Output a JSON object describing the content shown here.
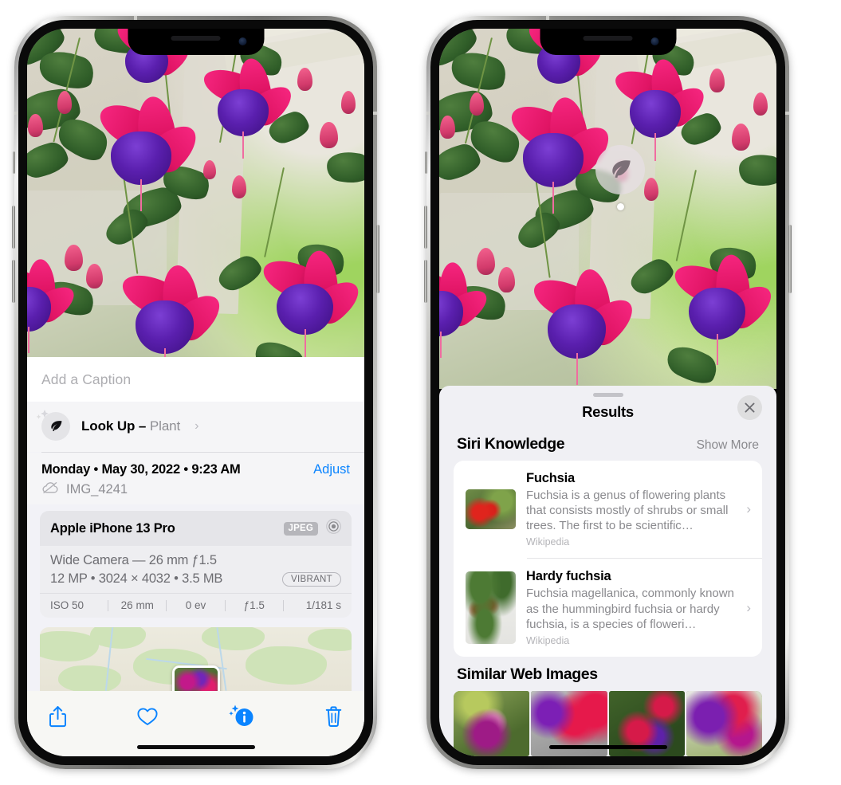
{
  "left_phone": {
    "caption": {
      "placeholder": "Add a Caption"
    },
    "lookup": {
      "label": "Look Up – ",
      "subject": "Plant",
      "chevron": "›",
      "icon": "leaf-icon"
    },
    "meta": {
      "date": "Monday • May 30, 2022 • 9:23 AM",
      "adjust": "Adjust",
      "filename": "IMG_4241",
      "cloud_icon": "cloud-slash-icon"
    },
    "camera": {
      "device": "Apple iPhone 13 Pro",
      "format_badge": "JPEG",
      "lens_icon": "aperture-icon",
      "lens_line": "Wide Camera — 26 mm ƒ1.5",
      "size_line": "12 MP • 3024 × 4032 • 3.5 MB",
      "style_badge": "VIBRANT",
      "exif": [
        "ISO 50",
        "26 mm",
        "0 ev",
        "ƒ1.5",
        "1/181 s"
      ]
    },
    "toolbar": [
      {
        "name": "share-button",
        "icon": "share-icon"
      },
      {
        "name": "favorite-button",
        "icon": "heart-icon"
      },
      {
        "name": "info-button",
        "icon": "info-sparkle-icon"
      },
      {
        "name": "delete-button",
        "icon": "trash-icon"
      }
    ]
  },
  "right_phone": {
    "visual_lookup_badge": {
      "icon": "leaf-icon"
    },
    "sheet": {
      "title": "Results",
      "close_icon": "close-icon"
    },
    "siri_knowledge": {
      "title": "Siri Knowledge",
      "show_more": "Show More",
      "items": [
        {
          "title": "Fuchsia",
          "description": "Fuchsia is a genus of flowering plants that consists mostly of shrubs or small trees. The first to be scientific…",
          "source": "Wikipedia",
          "chevron": "›"
        },
        {
          "title": "Hardy fuchsia",
          "description": "Fuchsia magellanica, commonly known as the hummingbird fuchsia or hardy fuchsia, is a species of floweri…",
          "source": "Wikipedia",
          "chevron": "›"
        }
      ]
    },
    "similar_web_images": {
      "title": "Similar Web Images",
      "count": 4
    }
  },
  "colors": {
    "accent_blue": "#0a84ff",
    "sheet_bg": "#f2f2f7",
    "card_bg": "#ffffff",
    "secondary_text": "#8e8e93"
  }
}
